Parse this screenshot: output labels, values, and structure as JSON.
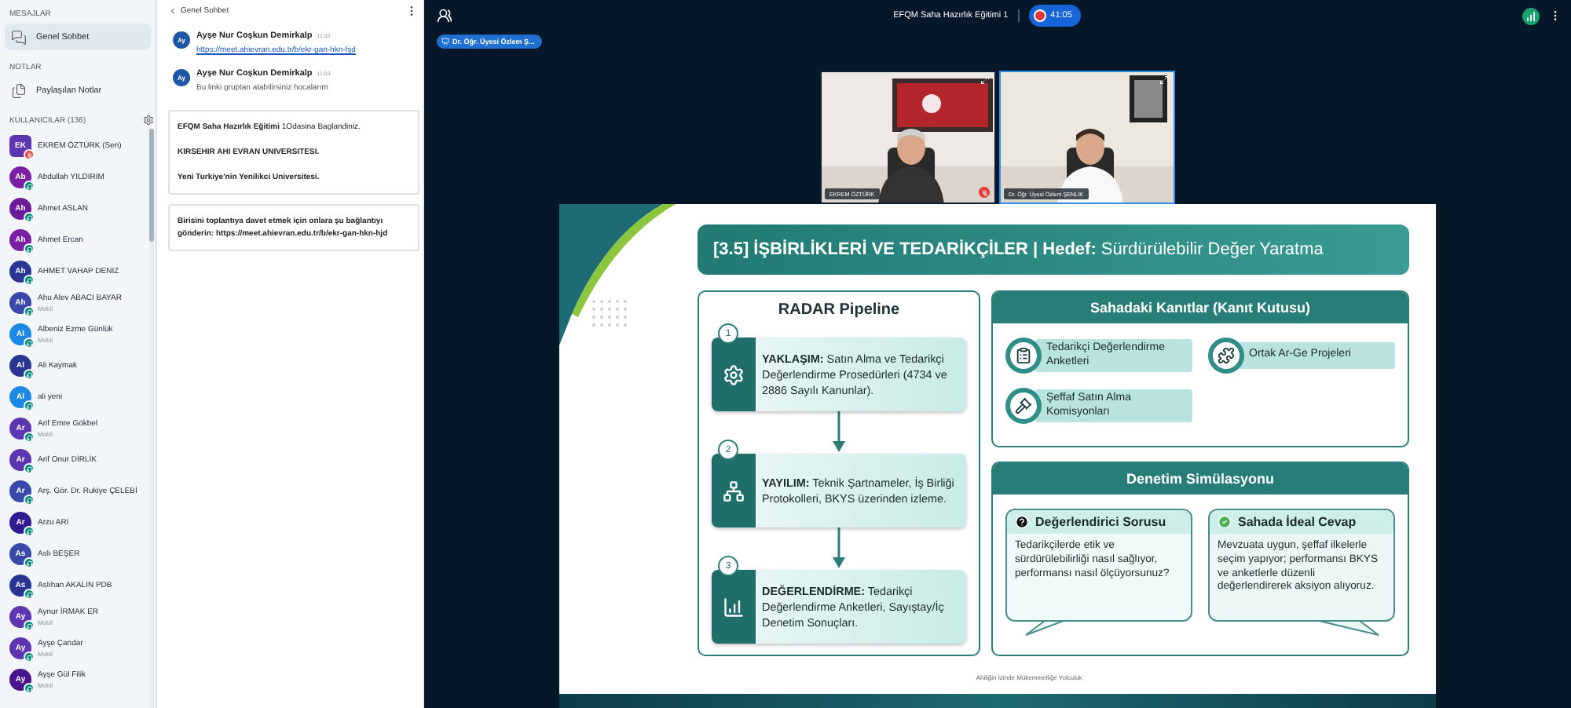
{
  "sidebar": {
    "messages_heading": "MESAJLAR",
    "messages": [
      {
        "label": "Genel Sohbet",
        "selected": true
      }
    ],
    "notes_heading": "NOTLAR",
    "notes": [
      {
        "label": "Paylaşılan Notlar",
        "selected": false
      }
    ],
    "users_heading": "KULLANICILAR (136)",
    "users": [
      {
        "initials": "EK",
        "name": "EKREM ÖZTÜRK (Sen)",
        "kind": "self",
        "color": "#5e35b1",
        "muted": true
      },
      {
        "initials": "Ab",
        "name": "Abdullah YILDIRIM",
        "kind": "attendee",
        "color": "#7b1fa2",
        "muted": false
      },
      {
        "initials": "Ah",
        "name": "Ahmet ASLAN",
        "kind": "attendee",
        "color": "#6a1b9a",
        "muted": false
      },
      {
        "initials": "Ah",
        "name": "Ahmet Ercan",
        "kind": "attendee",
        "color": "#7b1fa2",
        "muted": false
      },
      {
        "initials": "Ah",
        "name": "AHMET VAHAP DENIZ",
        "kind": "attendee",
        "color": "#283593",
        "muted": false
      },
      {
        "initials": "Ah",
        "name": "Ahu Alev ABACI BAYAR",
        "device": "Mobil",
        "kind": "attendee",
        "color": "#3949ab",
        "muted": false
      },
      {
        "initials": "Al",
        "name": "Albeniz Ezme Günlük",
        "device": "Mobil",
        "kind": "attendee",
        "color": "#1e88e5",
        "muted": false
      },
      {
        "initials": "Al",
        "name": "Ali Kaymak",
        "kind": "attendee",
        "color": "#283593",
        "muted": false
      },
      {
        "initials": "Al",
        "name": "ali yeni",
        "kind": "attendee",
        "color": "#1e88e5",
        "muted": false
      },
      {
        "initials": "Ar",
        "name": "Arif Emre Gökbel",
        "device": "Mobil",
        "kind": "attendee",
        "color": "#5e35b1",
        "muted": false
      },
      {
        "initials": "Ar",
        "name": "Arif Onur DİRLİK",
        "kind": "attendee",
        "color": "#5e35b1",
        "muted": false
      },
      {
        "initials": "Ar",
        "name": "Arş. Gör. Dr. Rukiye ÇELEBİ",
        "kind": "attendee",
        "color": "#3949ab",
        "muted": false
      },
      {
        "initials": "Ar",
        "name": "Arzu ARI",
        "kind": "attendee",
        "color": "#311b92",
        "muted": false
      },
      {
        "initials": "As",
        "name": "Aslı BEŞER",
        "kind": "attendee",
        "color": "#3949ab",
        "muted": false
      },
      {
        "initials": "As",
        "name": "Aslıhan AKALIN PDB",
        "kind": "attendee",
        "color": "#283593",
        "muted": false
      },
      {
        "initials": "Ay",
        "name": "Aynur İRMAK ER",
        "device": "Mobil",
        "kind": "attendee",
        "color": "#5e35b1",
        "muted": false
      },
      {
        "initials": "Ay",
        "name": "Ayşe Çandar",
        "device": "Mobil",
        "kind": "attendee",
        "color": "#5e35b1",
        "muted": false
      },
      {
        "initials": "Ay",
        "name": "Ayşe Gül Filik",
        "device": "Mobil",
        "kind": "attendee",
        "color": "#4a148c",
        "muted": false
      }
    ]
  },
  "chat": {
    "title": "Genel Sohbet",
    "messages": [
      {
        "initials": "Ay",
        "author": "Ayşe Nur Coşkun Demirkalp",
        "time": "11:03",
        "text": "https://meet.ahievran.edu.tr/b/ekr-gan-hkn-hjd",
        "kind": "link"
      },
      {
        "initials": "Ay",
        "author": "Ayşe Nur Coşkun Demirkalp",
        "time": "11:03",
        "text": "Bu linki gruptan atabilirsiniz hocalarım",
        "kind": "text"
      }
    ],
    "notices": [
      {
        "lines": [
          {
            "text": "**EFQM Saha Hazırlık Eğitimi** 1Odasina Baglandiniz.",
            "bold": false
          },
          {
            "text": "KIRSEHIR AHI EVRAN UNIVERSITESI.",
            "bold": true
          },
          {
            "text": "Yeni Turkiye'nin Yenilikci Universitesi.",
            "bold": true
          }
        ]
      },
      {
        "lines": [
          {
            "text": "Birisini toplantıya davet etmek için onlara şu bağlantıyı gönderin: https://meet.ahievran.edu.tr/b/ekr-gan-hkn-hjd",
            "bold": true
          }
        ]
      }
    ]
  },
  "topbar": {
    "title": "EFQM Saha Hazırlık Eğitimi 1",
    "recording": {
      "time": "41:05",
      "on": true
    },
    "presenter": "Dr. Öğr. Üyesi Özlem Ş..."
  },
  "videos": [
    {
      "name": "EKREM ÖZTÜRK",
      "muted": true,
      "talking": false
    },
    {
      "name": "Dr. Öğr. Üyesi Özlem ŞENLİK",
      "muted": false,
      "talking": true
    }
  ],
  "slide": {
    "title": "**[3.5] İŞBİRLİKLERİ VE TEDARİKÇİLER | Hedef:** Sürdürülebilir Değer Yaratma",
    "pipeline": {
      "title": "RADAR Pipeline",
      "steps": [
        {
          "number": "1",
          "text": "**YAKLAŞIM:** Satın Alma ve Tedarikçi Değerlendirme Prosedürleri (4734 ve 2886 Sayılı Kanunlar)."
        },
        {
          "number": "2",
          "text": "**YAYILIM:** Teknik Şartnameler, İş Birliği Protokolleri, BKYS üzerinden izleme."
        },
        {
          "number": "3",
          "text": "**DEĞERLENDİRME:** Tedarikçi Değerlendirme Anketleri, Sayıştay/İç Denetim Sonuçları."
        }
      ]
    },
    "evidence": {
      "title": "Sahadaki Kanıtlar (Kanıt Kutusu)",
      "items": [
        "Tedarikçi Değerlendirme Anketleri",
        "Ortak Ar-Ge Projeleri",
        "Şeffaf Satın Alma Komisyonları"
      ]
    },
    "simulation": {
      "title": "Denetim Simülasyonu",
      "bubbles": [
        {
          "kind": "question",
          "title": "Değerlendirici Sorusu",
          "text": "Tedarikçilerde etik ve sürdürülebilirliği nasıl sağlıyor, performansı nasıl ölçüyorsunuz?"
        },
        {
          "kind": "answer",
          "title": "Sahada İdeal Cevap",
          "text": "Mevzuata uygun, şeffaf ilkelerle seçim yapıyor; performansı BKYS ve anketlerle düzenli değerlendirerek aksiyon alıyoruz."
        }
      ]
    },
    "footer": "Ahiliğin İzinde Mükemmelliğe Yolculuk"
  }
}
